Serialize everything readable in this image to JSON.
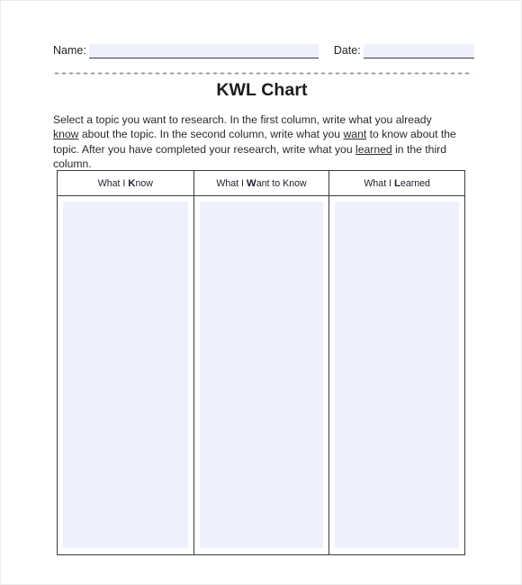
{
  "document": {
    "title": "KWL Chart",
    "fields": [
      {
        "label": "Name:",
        "value": "",
        "name": "name-field"
      },
      {
        "label": "Date:",
        "value": "",
        "name": "date-field"
      }
    ],
    "instructions": {
      "line1_a": "Select a topic you want to research. In the first column, write what you already ",
      "line1_u": "know",
      "line2_a": " about the topic. In the second column, write what you ",
      "line2_u": "want",
      "line2_b": " to know about the topic. After you have completed your research, write what you ",
      "line3_u": "learned",
      "line3_b": " in the third column."
    },
    "table": {
      "columns": [
        {
          "lead": "What I ",
          "key": "K",
          "rest": "now",
          "full": "What I Know",
          "cell_value": ""
        },
        {
          "lead": "What I ",
          "key": "W",
          "rest": "ant to Know",
          "full": "What I Want to Know",
          "cell_value": ""
        },
        {
          "lead": "What I ",
          "key": "L",
          "rest": "earned",
          "full": "What I Learned",
          "cell_value": ""
        }
      ]
    },
    "colors": {
      "field_fill": "#eef0fb",
      "border": "#3a3a42",
      "dot_rule": "#9a9a9a",
      "text": "#2a2a2a"
    }
  }
}
